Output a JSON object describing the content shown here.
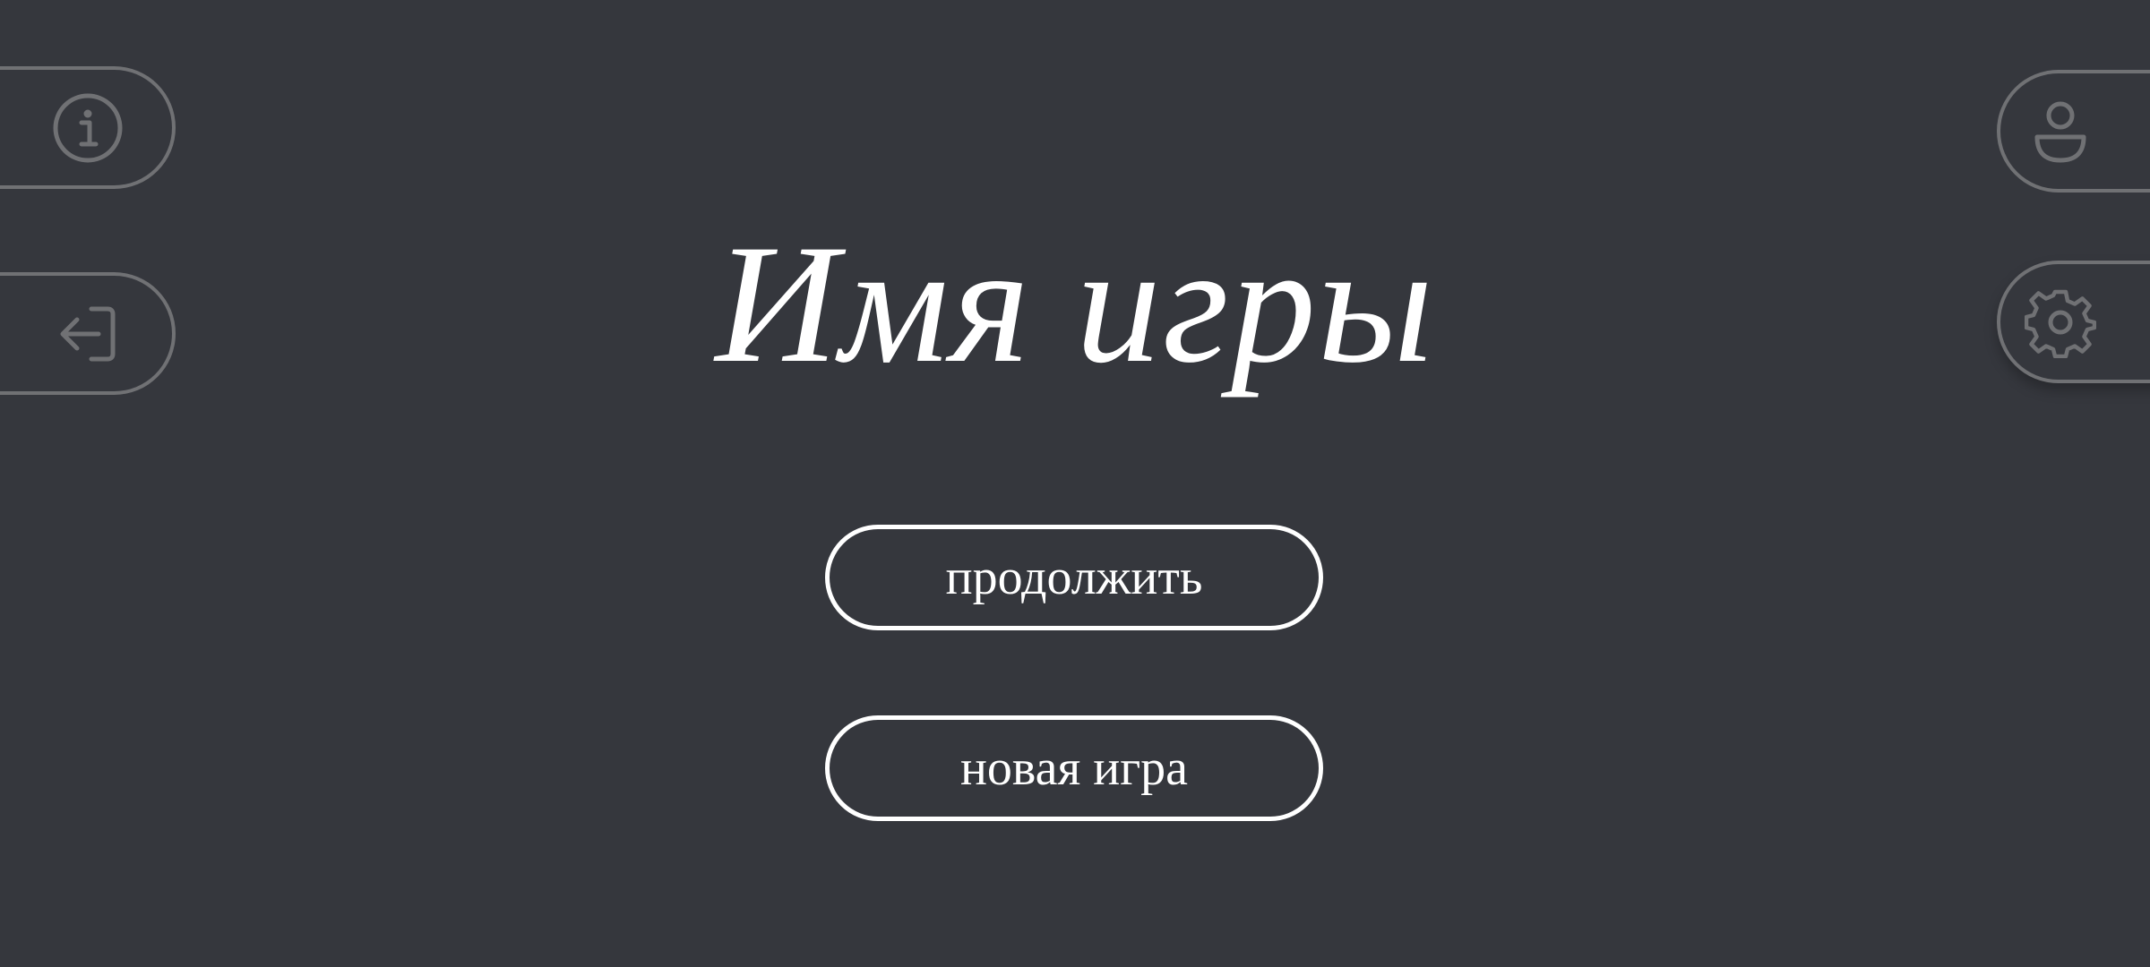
{
  "game": {
    "title": "Имя игры"
  },
  "menu": {
    "continue_label": "продолжить",
    "new_game_label": "новая игра"
  },
  "side_buttons": {
    "info_icon": "info-icon",
    "exit_icon": "exit-arrow-icon",
    "profile_icon": "user-icon",
    "settings_icon": "gear-icon"
  },
  "colors": {
    "background": "#35373d",
    "primary": "#ffffff",
    "muted": "#707174"
  }
}
